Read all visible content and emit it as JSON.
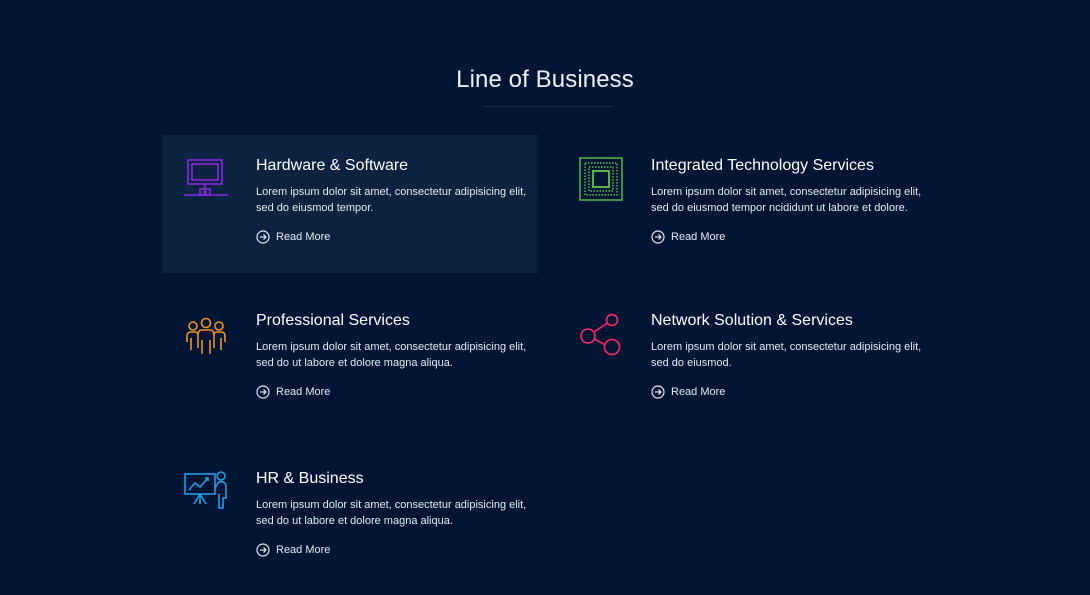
{
  "section": {
    "title": "Line of Business"
  },
  "colors": {
    "background": "#001533",
    "active_card": "#0b2240",
    "hardware_icon": "#8a2be2",
    "integrated_icon": "#55c84a",
    "professional_icon": "#f5921e",
    "network_icon": "#e8285f",
    "hr_icon": "#1b9ee6"
  },
  "cards": [
    {
      "title": "Hardware & Software",
      "description": "Lorem ipsum dolor sit amet, consectetur adipisicing elit, sed do eiusmod tempor.",
      "link": "Read More",
      "icon": "monitor-icon",
      "active": true
    },
    {
      "title": "Integrated Technology Services",
      "description": "Lorem ipsum dolor sit amet, consectetur adipisicing elit, sed do eiusmod tempor ncididunt ut labore et dolore.",
      "link": "Read More",
      "icon": "chip-icon",
      "active": false
    },
    {
      "title": "Professional Services",
      "description": "Lorem ipsum dolor sit amet, consectetur adipisicing elit, sed do ut labore et dolore magna aliqua.",
      "link": "Read More",
      "icon": "team-icon",
      "active": false
    },
    {
      "title": "Network Solution & Services",
      "description": "Lorem ipsum dolor sit amet, consectetur adipisicing elit, sed do eiusmod.",
      "link": "Read More",
      "icon": "share-icon",
      "active": false
    },
    {
      "title": "HR & Business",
      "description": "Lorem ipsum dolor sit amet, consectetur adipisicing elit, sed do ut labore et dolore magna aliqua.",
      "link": "Read More",
      "icon": "presentation-icon",
      "active": false
    }
  ]
}
